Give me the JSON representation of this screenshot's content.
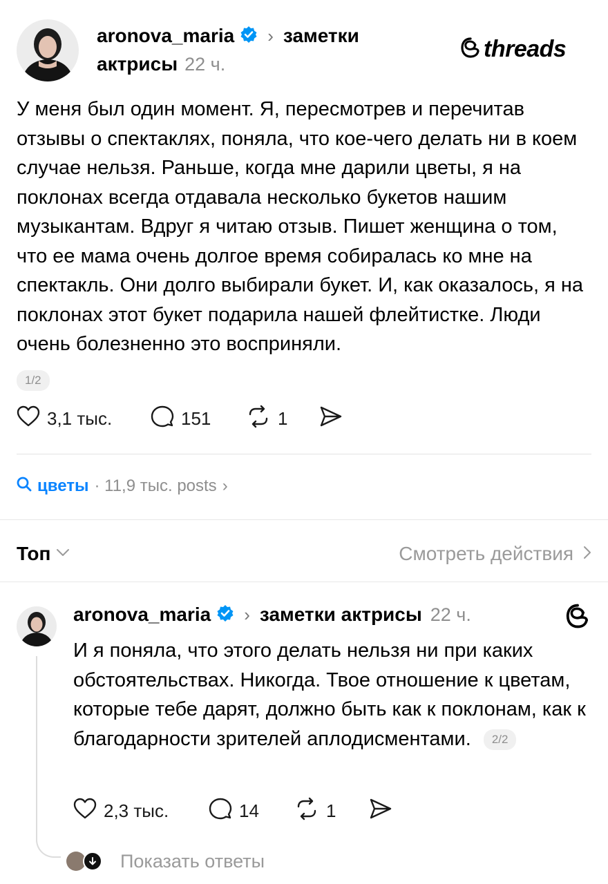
{
  "post": {
    "username": "aronova_maria",
    "separator": "›",
    "topic_line1": "заметки",
    "topic_line2": "актрисы",
    "time": "22 ч.",
    "brand": "threads",
    "text": "У меня был один момент. Я, пересмотрев и перечитав отзывы о спектаклях, поняла, что кое-чего делать ни в коем случае нельзя. Раньше, когда мне дарили цветы, я на поклонах всегда отдавала несколько букетов нашим музыкантам. Вдруг я читаю отзыв. Пишет женщина о том, что ее мама очень долгое время собиралась ко мне на спектакль. Они долго выбирали букет. И, как оказалось, я на поклонах этот букет подарила нашей флейтистке. Люди очень болезненно это восприняли.",
    "page_badge": "1/2",
    "likes": "3,1 тыс.",
    "comments": "151",
    "reposts": "1"
  },
  "tag": {
    "name": "цветы",
    "count": "· 11,9 тыс. posts",
    "arrow": "›"
  },
  "sort": {
    "label": "Топ",
    "view_activity": "Смотреть действия"
  },
  "reply": {
    "username": "aronova_maria",
    "separator": "›",
    "topic": "заметки актрисы",
    "time": "22 ч.",
    "text": "И я поняла, что этого делать нельзя ни при каких обстоятельствах. Никогда. Твое отношение к цветам, которые тебе дарят, должно быть как к поклонам, как к благодарности зрителей аплодисментами.",
    "page_badge": "2/2",
    "likes": "2,3 тыс.",
    "comments": "14",
    "reposts": "1",
    "show_replies": "Показать ответы"
  },
  "colors": {
    "verified": "#0095f6",
    "link": "#0a84ff",
    "muted": "#8e8e8e"
  }
}
